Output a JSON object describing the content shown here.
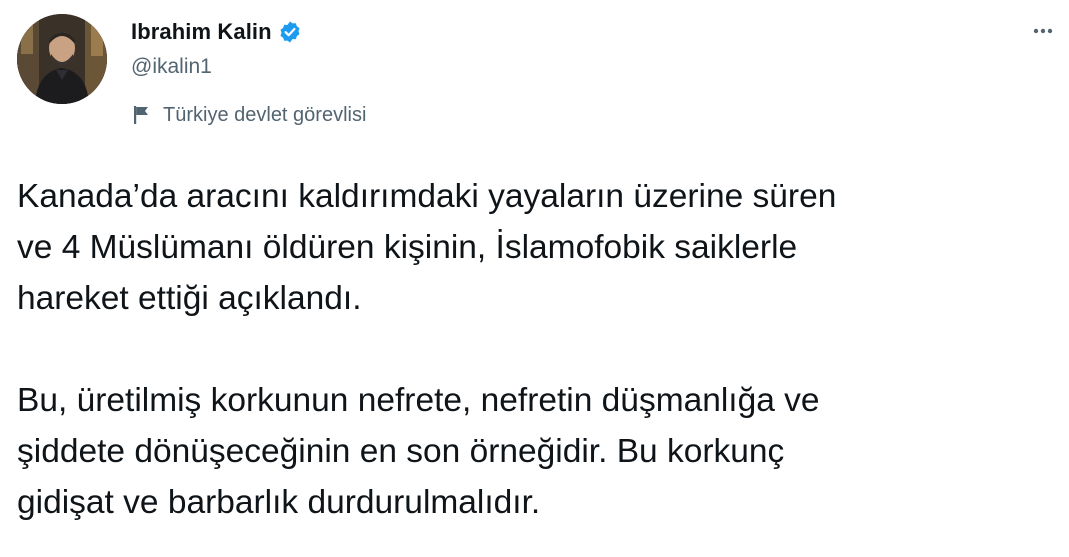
{
  "author": {
    "display_name": "Ibrahim Kalin",
    "handle": "@ikalin1",
    "verified": true,
    "label": "Türkiye devlet görevlisi"
  },
  "icons": {
    "verified": "verified-badge-icon",
    "label": "flag-icon",
    "more": "more-options-icon"
  },
  "tweet": {
    "paragraph_1": {
      "line_1": "Kanada’da aracını kaldırımdaki yayaların üzerine süren",
      "line_2": "ve 4 Müslümanı öldüren kişinin, İslamofobik saiklerle",
      "line_3": "hareket ettiği açıklandı."
    },
    "paragraph_2": {
      "line_1": "Bu, üretilmiş korkunun nefrete, nefretin düşmanlığa ve",
      "line_2": "şiddete dönüşeceğinin en son örneğidir. Bu korkunç",
      "line_3": "gidişat ve barbarlık durdurulmalıdır."
    }
  },
  "colors": {
    "verified_blue": "#1d9bf0",
    "secondary_text": "#536471",
    "primary_text": "#0f1419"
  }
}
